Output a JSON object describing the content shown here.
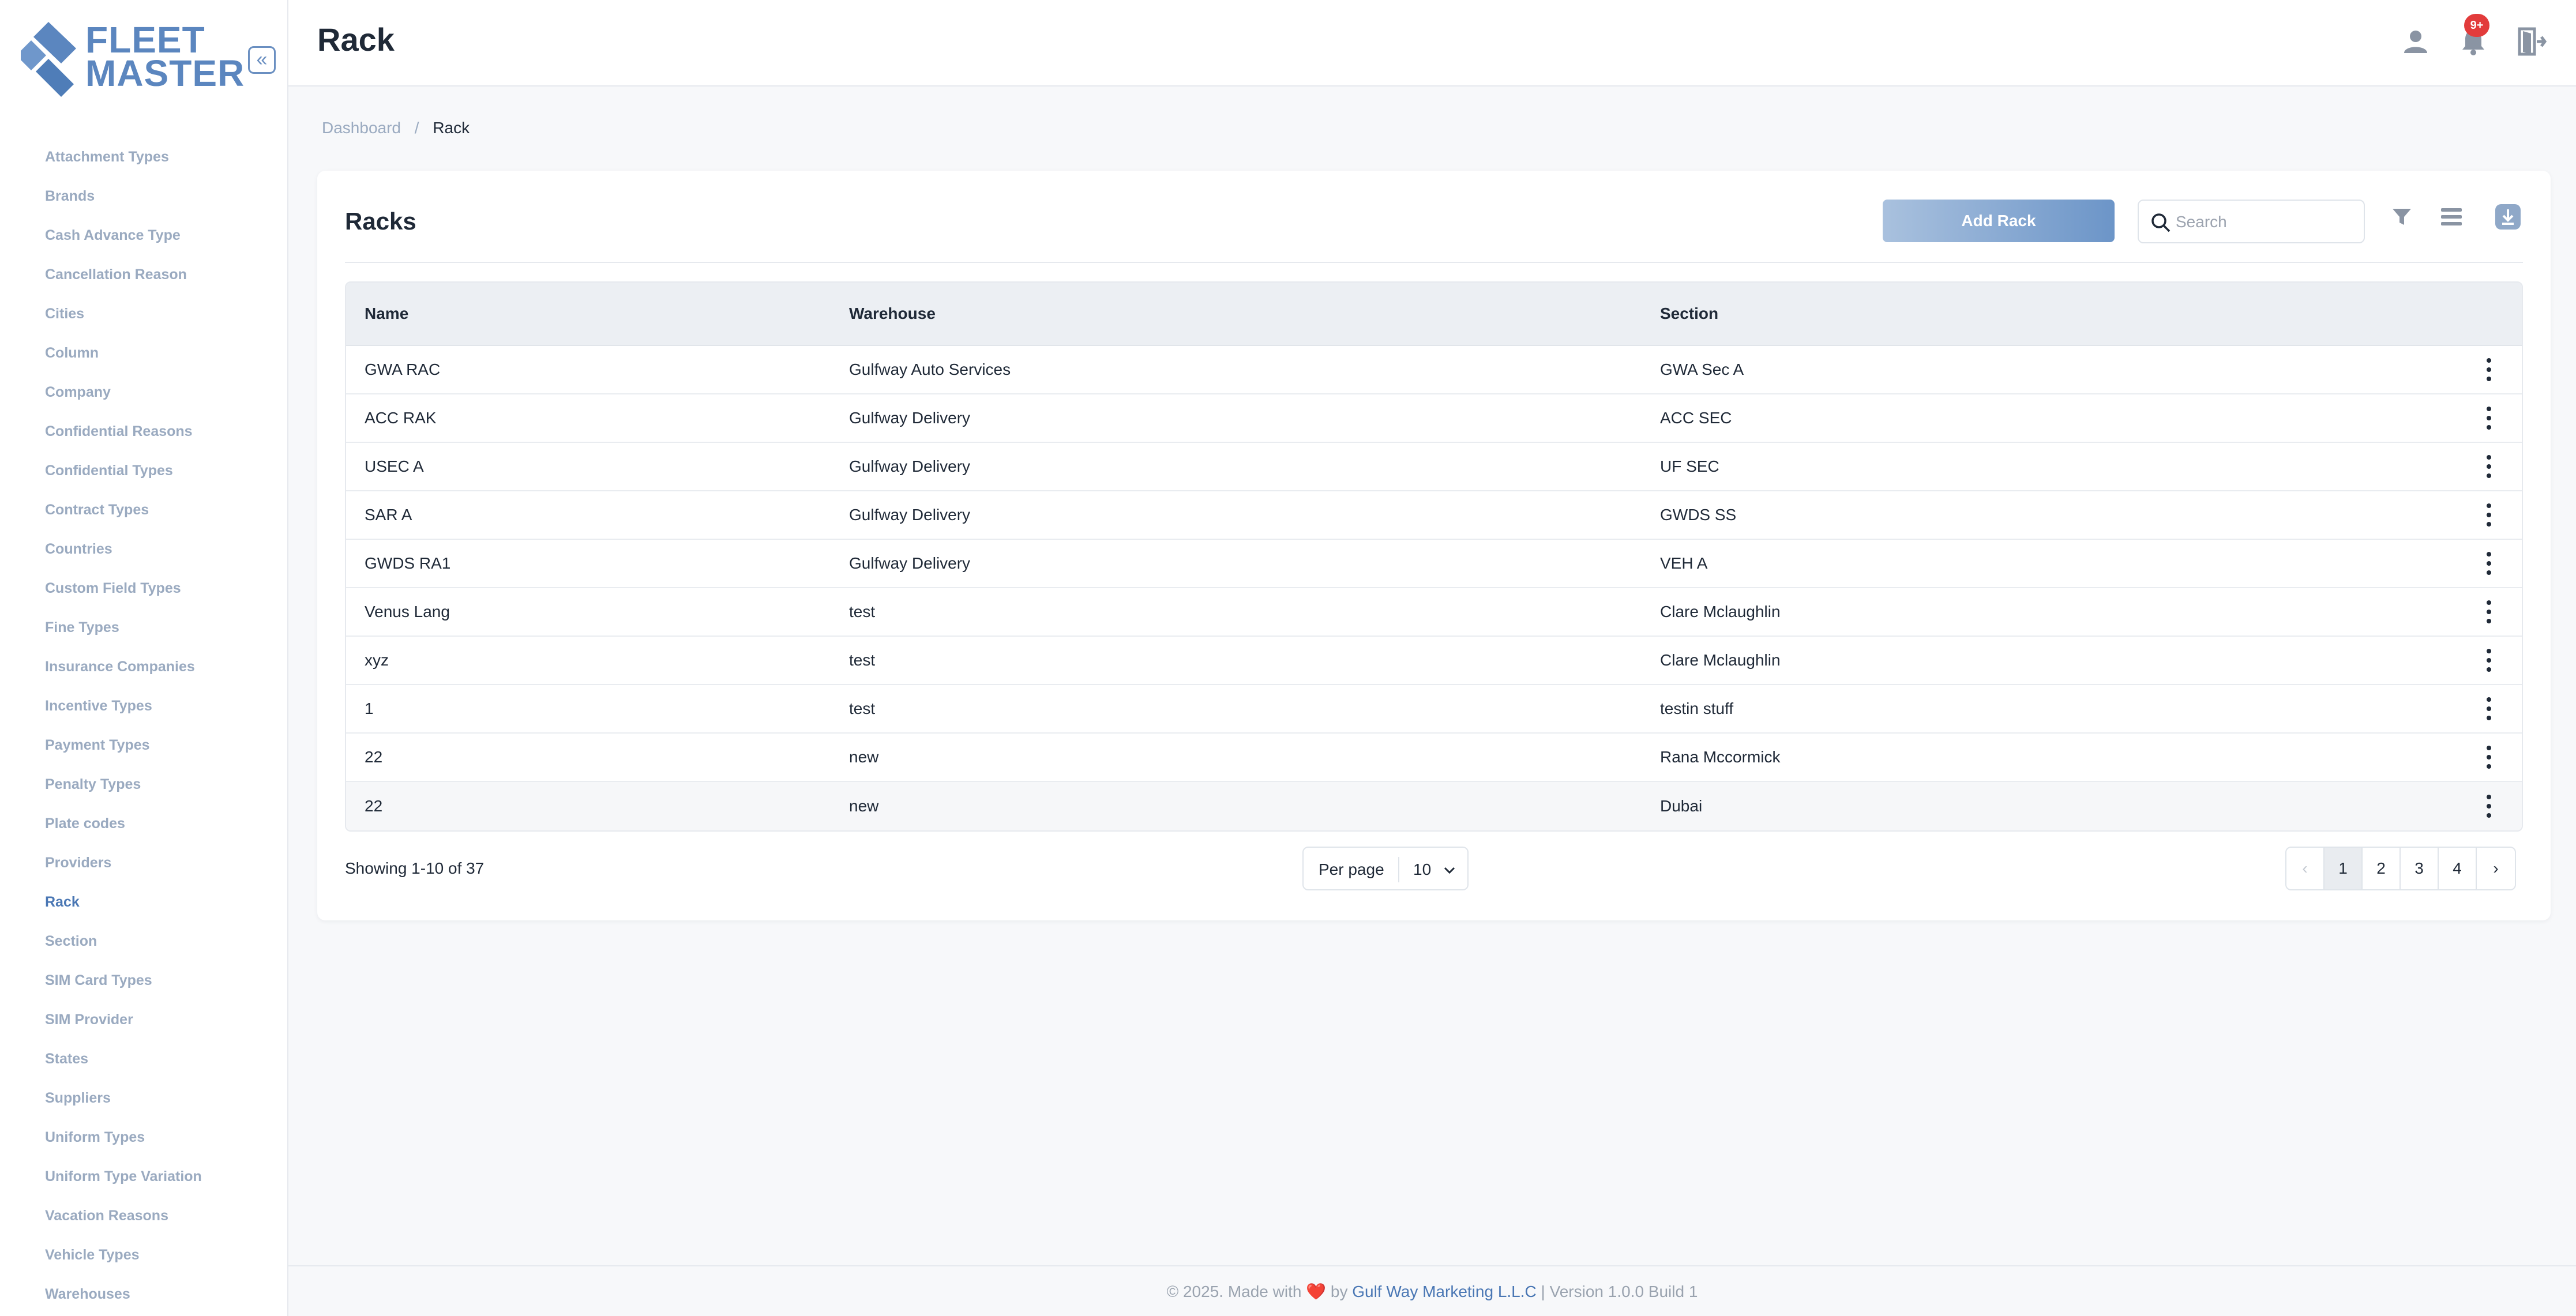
{
  "app": {
    "logo_line1": "FLEET",
    "logo_line2": "MASTER",
    "brand_color": "#5b86bf"
  },
  "sidebar": {
    "items": [
      {
        "label": "Attachment Types"
      },
      {
        "label": "Brands"
      },
      {
        "label": "Cash Advance Type"
      },
      {
        "label": "Cancellation Reason"
      },
      {
        "label": "Cities"
      },
      {
        "label": "Column"
      },
      {
        "label": "Company"
      },
      {
        "label": "Confidential Reasons"
      },
      {
        "label": "Confidential Types"
      },
      {
        "label": "Contract Types"
      },
      {
        "label": "Countries"
      },
      {
        "label": "Custom Field Types"
      },
      {
        "label": "Fine Types"
      },
      {
        "label": "Insurance Companies"
      },
      {
        "label": "Incentive Types"
      },
      {
        "label": "Payment Types"
      },
      {
        "label": "Penalty Types"
      },
      {
        "label": "Plate codes"
      },
      {
        "label": "Providers"
      },
      {
        "label": "Rack",
        "active": true
      },
      {
        "label": "Section"
      },
      {
        "label": "SIM Card Types"
      },
      {
        "label": "SIM Provider"
      },
      {
        "label": "States"
      },
      {
        "label": "Suppliers"
      },
      {
        "label": "Uniform Types"
      },
      {
        "label": "Uniform Type Variation"
      },
      {
        "label": "Vacation Reasons"
      },
      {
        "label": "Vehicle Types"
      },
      {
        "label": "Warehouses"
      }
    ]
  },
  "header": {
    "title": "Rack",
    "notification_badge": "9+",
    "icons": [
      "user-icon",
      "bell-icon",
      "logout-icon"
    ]
  },
  "breadcrumb": {
    "home": "Dashboard",
    "separator": "/",
    "current": "Rack"
  },
  "card": {
    "title": "Racks",
    "add_button": "Add Rack",
    "search_placeholder": "Search",
    "search_value": ""
  },
  "table": {
    "columns": [
      "Name",
      "Warehouse",
      "Section"
    ],
    "rows": [
      {
        "name": "GWA RAC",
        "warehouse": "Gulfway Auto Services",
        "section": "GWA Sec A"
      },
      {
        "name": "ACC RAK",
        "warehouse": "Gulfway Delivery",
        "section": "ACC SEC"
      },
      {
        "name": "USEC A",
        "warehouse": "Gulfway Delivery",
        "section": "UF SEC"
      },
      {
        "name": "SAR A",
        "warehouse": "Gulfway Delivery",
        "section": "GWDS SS"
      },
      {
        "name": "GWDS RA1",
        "warehouse": "Gulfway Delivery",
        "section": "VEH A"
      },
      {
        "name": "Venus Lang",
        "warehouse": "test",
        "section": "Clare Mclaughlin"
      },
      {
        "name": "xyz",
        "warehouse": "test",
        "section": "Clare Mclaughlin"
      },
      {
        "name": "1",
        "warehouse": "test",
        "section": "testin stuff"
      },
      {
        "name": "22",
        "warehouse": "new",
        "section": "Rana Mccormick"
      },
      {
        "name": "22",
        "warehouse": "new",
        "section": "Dubai"
      }
    ]
  },
  "pagination": {
    "showing": "Showing 1-10 of 37",
    "per_page_label": "Per page",
    "per_page_value": "10",
    "pages": [
      "1",
      "2",
      "3",
      "4"
    ],
    "current": "1"
  },
  "footer": {
    "prefix": "© 2025. Made with",
    "heart": "❤️",
    "by": "by",
    "company": "Gulf Way Marketing L.L.C",
    "version": "| Version 1.0.0 Build 1"
  }
}
